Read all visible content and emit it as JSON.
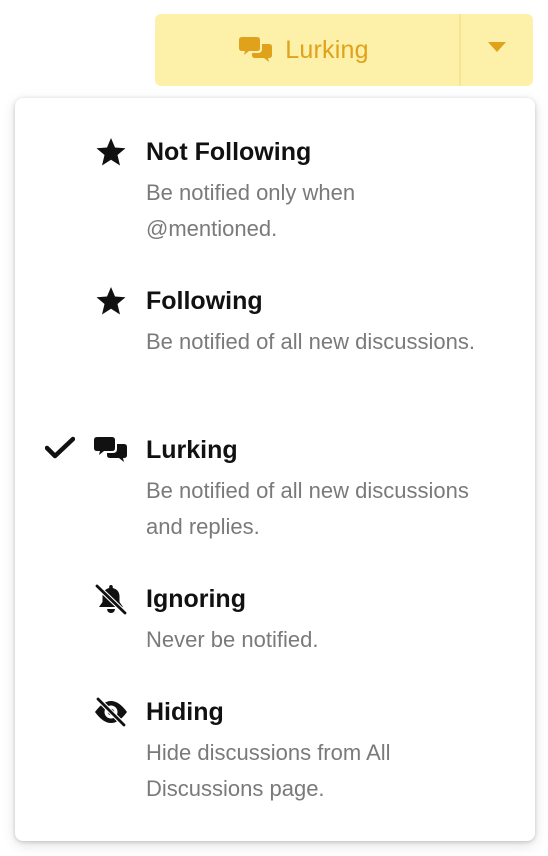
{
  "button": {
    "label": "Lurking",
    "icon": "comments-icon",
    "caret_icon": "caret-down-icon",
    "bg_color": "#fdf0a8",
    "text_color": "#e0a21a"
  },
  "menu": {
    "selected": "Lurking",
    "items": [
      {
        "title": "Not Following",
        "description": "Be notified only when @mentioned.",
        "icon": "star-icon",
        "checked": false
      },
      {
        "title": "Following",
        "description": "Be notified of all new discussions.",
        "icon": "star-icon",
        "checked": false
      },
      {
        "title": "Lurking",
        "description": "Be notified of all new discussions and replies.",
        "icon": "comments-icon",
        "checked": true
      },
      {
        "title": "Ignoring",
        "description": "Never be notified.",
        "icon": "bell-slash-icon",
        "checked": false
      },
      {
        "title": "Hiding",
        "description": "Hide discussions from All Discussions page.",
        "icon": "eye-slash-icon",
        "checked": false
      }
    ]
  }
}
